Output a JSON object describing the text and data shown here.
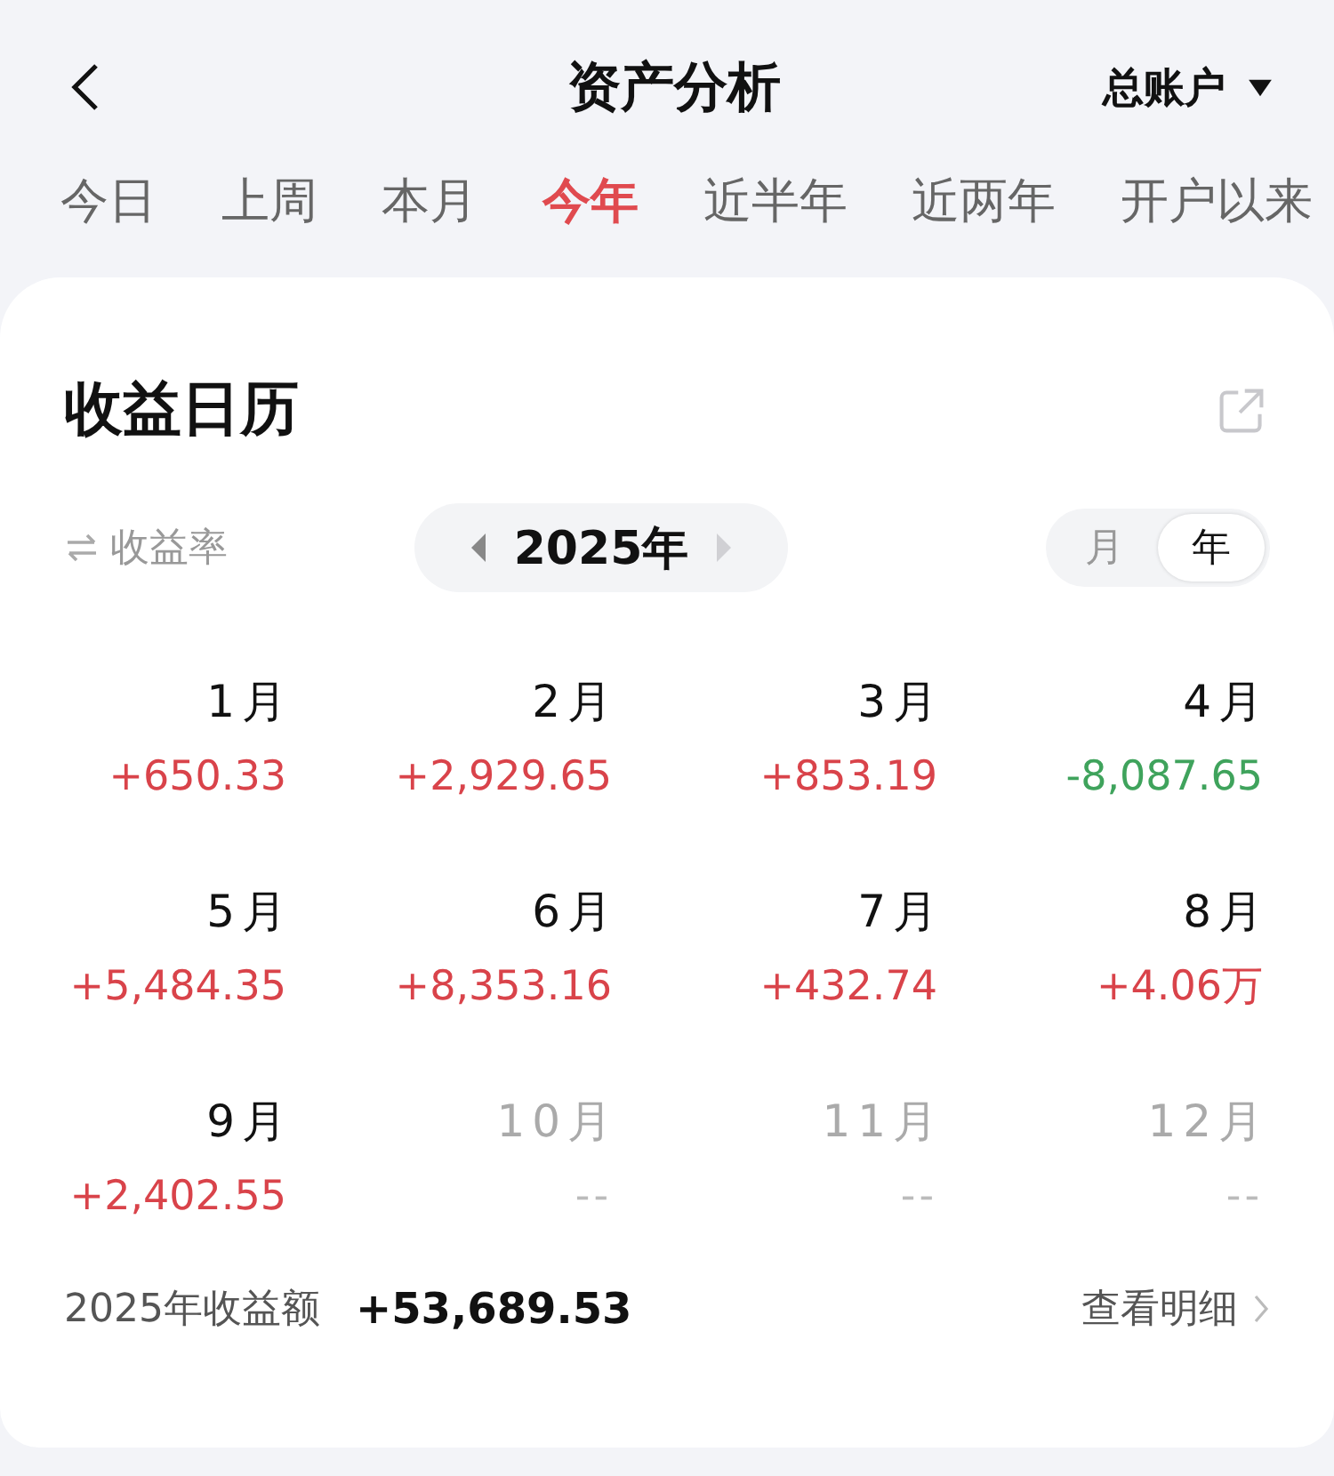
{
  "header": {
    "title": "资产分析",
    "account": "总账户"
  },
  "periods": [
    {
      "label": "今日",
      "selected": false
    },
    {
      "label": "上周",
      "selected": false
    },
    {
      "label": "本月",
      "selected": false
    },
    {
      "label": "今年",
      "selected": true
    },
    {
      "label": "近半年",
      "selected": false
    },
    {
      "label": "近两年",
      "selected": false
    },
    {
      "label": "开户以来",
      "selected": false
    }
  ],
  "card": {
    "title": "收益日历",
    "metric_toggle": "收益率",
    "year": "2025年",
    "prev_disabled": false,
    "next_disabled": true,
    "modes": [
      {
        "label": "月",
        "selected": false
      },
      {
        "label": "年",
        "selected": true
      }
    ],
    "months": [
      {
        "label": "1月",
        "value": "+650.33",
        "kind": "gain"
      },
      {
        "label": "2月",
        "value": "+2,929.65",
        "kind": "gain"
      },
      {
        "label": "3月",
        "value": "+853.19",
        "kind": "gain"
      },
      {
        "label": "4月",
        "value": "-8,087.65",
        "kind": "loss"
      },
      {
        "label": "5月",
        "value": "+5,484.35",
        "kind": "gain"
      },
      {
        "label": "6月",
        "value": "+8,353.16",
        "kind": "gain"
      },
      {
        "label": "7月",
        "value": "+432.74",
        "kind": "gain"
      },
      {
        "label": "8月",
        "value": "+4.06万",
        "kind": "gain"
      },
      {
        "label": "9月",
        "value": "+2,402.55",
        "kind": "gain"
      },
      {
        "label": "10月",
        "value": "--",
        "kind": "empty"
      },
      {
        "label": "11月",
        "value": "--",
        "kind": "empty"
      },
      {
        "label": "12月",
        "value": "--",
        "kind": "empty"
      }
    ],
    "total_label": "2025年收益额",
    "total_value": "+53,689.53",
    "detail_link": "查看明细"
  }
}
